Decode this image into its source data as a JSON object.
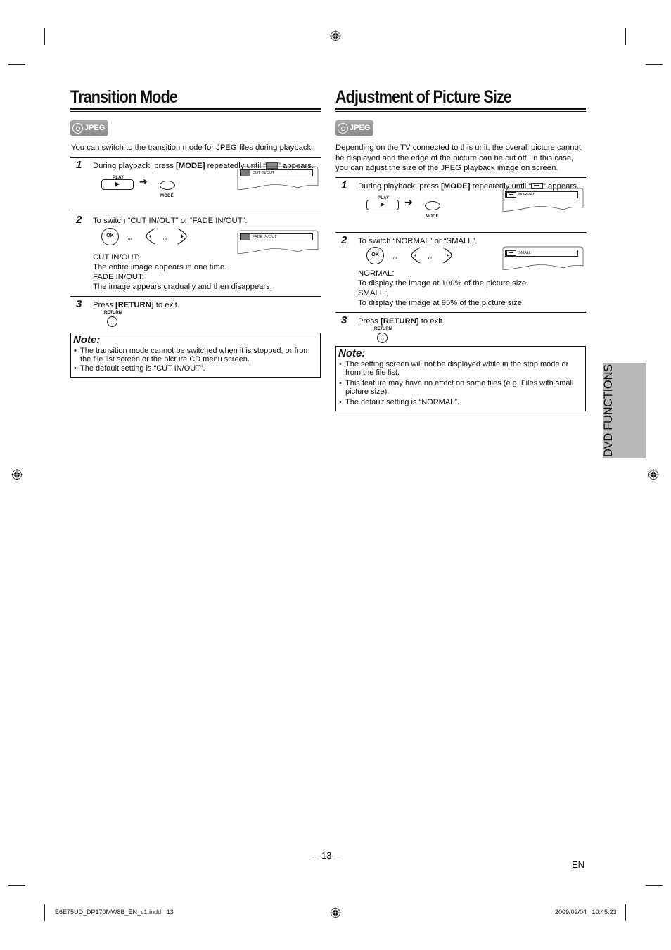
{
  "left": {
    "title": "Transition Mode",
    "badge": "JPEG",
    "intro": "You can switch to the transition mode for JPEG files during playback.",
    "steps": [
      {
        "num": "1",
        "text_pre": "During playback, press ",
        "text_bold": "[MODE]",
        "text_post": " repeatedly until “",
        "text_end": "” appears.",
        "play_label": "PLAY",
        "mode_label": "MODE",
        "osd_text": "CUT    IN/OUT"
      },
      {
        "num": "2",
        "text": "To switch “CUT IN/OUT” or “FADE IN/OUT”.",
        "ok_label": "OK",
        "or1": "or",
        "or2": "or",
        "osd_text": "FADE  IN/OUT",
        "desc": [
          "CUT IN/OUT:",
          "The entire image appears in one time.",
          "FADE IN/OUT:",
          "The image appears gradually and then disappears."
        ]
      },
      {
        "num": "3",
        "text_pre": "Press ",
        "text_bold": "[RETURN]",
        "text_post": " to exit.",
        "return_label": "RETURN"
      }
    ],
    "note": {
      "title": "Note:",
      "items": [
        "The transition mode cannot be switched when it is stopped, or from the file list screen or the picture CD menu screen.",
        "The default setting is “CUT IN/OUT”."
      ]
    }
  },
  "right": {
    "title": "Adjustment of Picture Size",
    "badge": "JPEG",
    "intro": "Depending on the TV connected to this unit, the overall picture cannot be displayed and the edge of the picture can be cut off. In this case, you can adjust the size of the JPEG playback image on screen.",
    "steps": [
      {
        "num": "1",
        "text_pre": "During playback, press ",
        "text_bold": "[MODE]",
        "text_post": " repeatedly until “",
        "text_end": "” appears.",
        "play_label": "PLAY",
        "mode_label": "MODE",
        "osd_text": "NORMAL"
      },
      {
        "num": "2",
        "text": "To switch “NORMAL” or “SMALL”.",
        "ok_label": "OK",
        "or1": "or",
        "or2": "or",
        "osd_text": "SMALL",
        "desc": [
          "NORMAL:",
          "To display the image at 100% of the picture size.",
          "SMALL:",
          "To display the image at 95% of the picture size."
        ]
      },
      {
        "num": "3",
        "text_pre": "Press ",
        "text_bold": "[RETURN]",
        "text_post": " to exit.",
        "return_label": "RETURN"
      }
    ],
    "note": {
      "title": "Note:",
      "items": [
        "The setting screen will not be displayed while in the stop mode or from the file list.",
        "This feature may have no effect on some files (e.g. Files with small picture size).",
        "The default setting is “NORMAL”."
      ]
    }
  },
  "side_tab": "DVD FUNCTIONS",
  "footer": {
    "page_number": "– 13 –",
    "lang": "EN",
    "file_info": "E6E75UD_DP170MW8B_EN_v1.indd   13",
    "timestamp": "2009/02/04   10:45:23"
  }
}
